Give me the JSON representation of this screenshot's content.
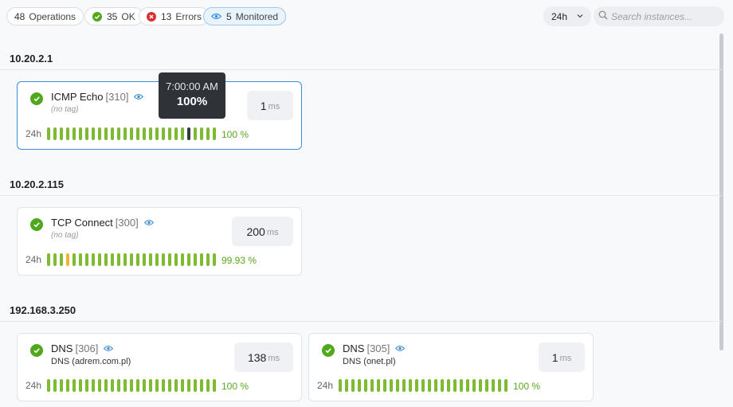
{
  "filters": {
    "operations": {
      "count": "48",
      "label": "Operations"
    },
    "ok": {
      "count": "35",
      "label": "OK"
    },
    "errors": {
      "count": "13",
      "label": "Errors"
    },
    "monitored": {
      "count": "5",
      "label": "Monitored"
    }
  },
  "time_range": "24h",
  "search": {
    "placeholder": "Search instances...",
    "value": ""
  },
  "colors": {
    "ok": "#4fa81d",
    "error": "#d9312f",
    "bar_ok": "#7dbb33",
    "bar_warn": "#f2b233",
    "accent": "#3f8fd6"
  },
  "groups": [
    {
      "title": "10.20.2.1",
      "cards": [
        {
          "name": "ICMP Echo",
          "id": "[310]",
          "sub": "(no tag)",
          "latency": "1",
          "unit": "ms",
          "range": "24h",
          "pct": "100 %",
          "status": "ok",
          "monitored": true
        }
      ]
    },
    {
      "title": "10.20.2.115",
      "cards": [
        {
          "name": "TCP Connect",
          "id": "[300]",
          "sub": "(no tag)",
          "latency": "200",
          "unit": "ms",
          "range": "24h",
          "pct": "99.93 %",
          "status": "ok",
          "monitored": true
        }
      ]
    },
    {
      "title": "192.168.3.250",
      "cards": [
        {
          "name": "DNS",
          "id": "[306]",
          "sub": "DNS (adrem.com.pl)",
          "latency": "138",
          "unit": "ms",
          "range": "24h",
          "pct": "100 %",
          "status": "ok",
          "monitored": true
        },
        {
          "name": "DNS",
          "id": "[305]",
          "sub": "DNS (onet.pl)",
          "latency": "1",
          "unit": "ms",
          "range": "24h",
          "pct": "100 %",
          "status": "ok",
          "monitored": true
        }
      ]
    }
  ],
  "tooltip": {
    "time": "7:00:00 AM",
    "value": "100%"
  }
}
